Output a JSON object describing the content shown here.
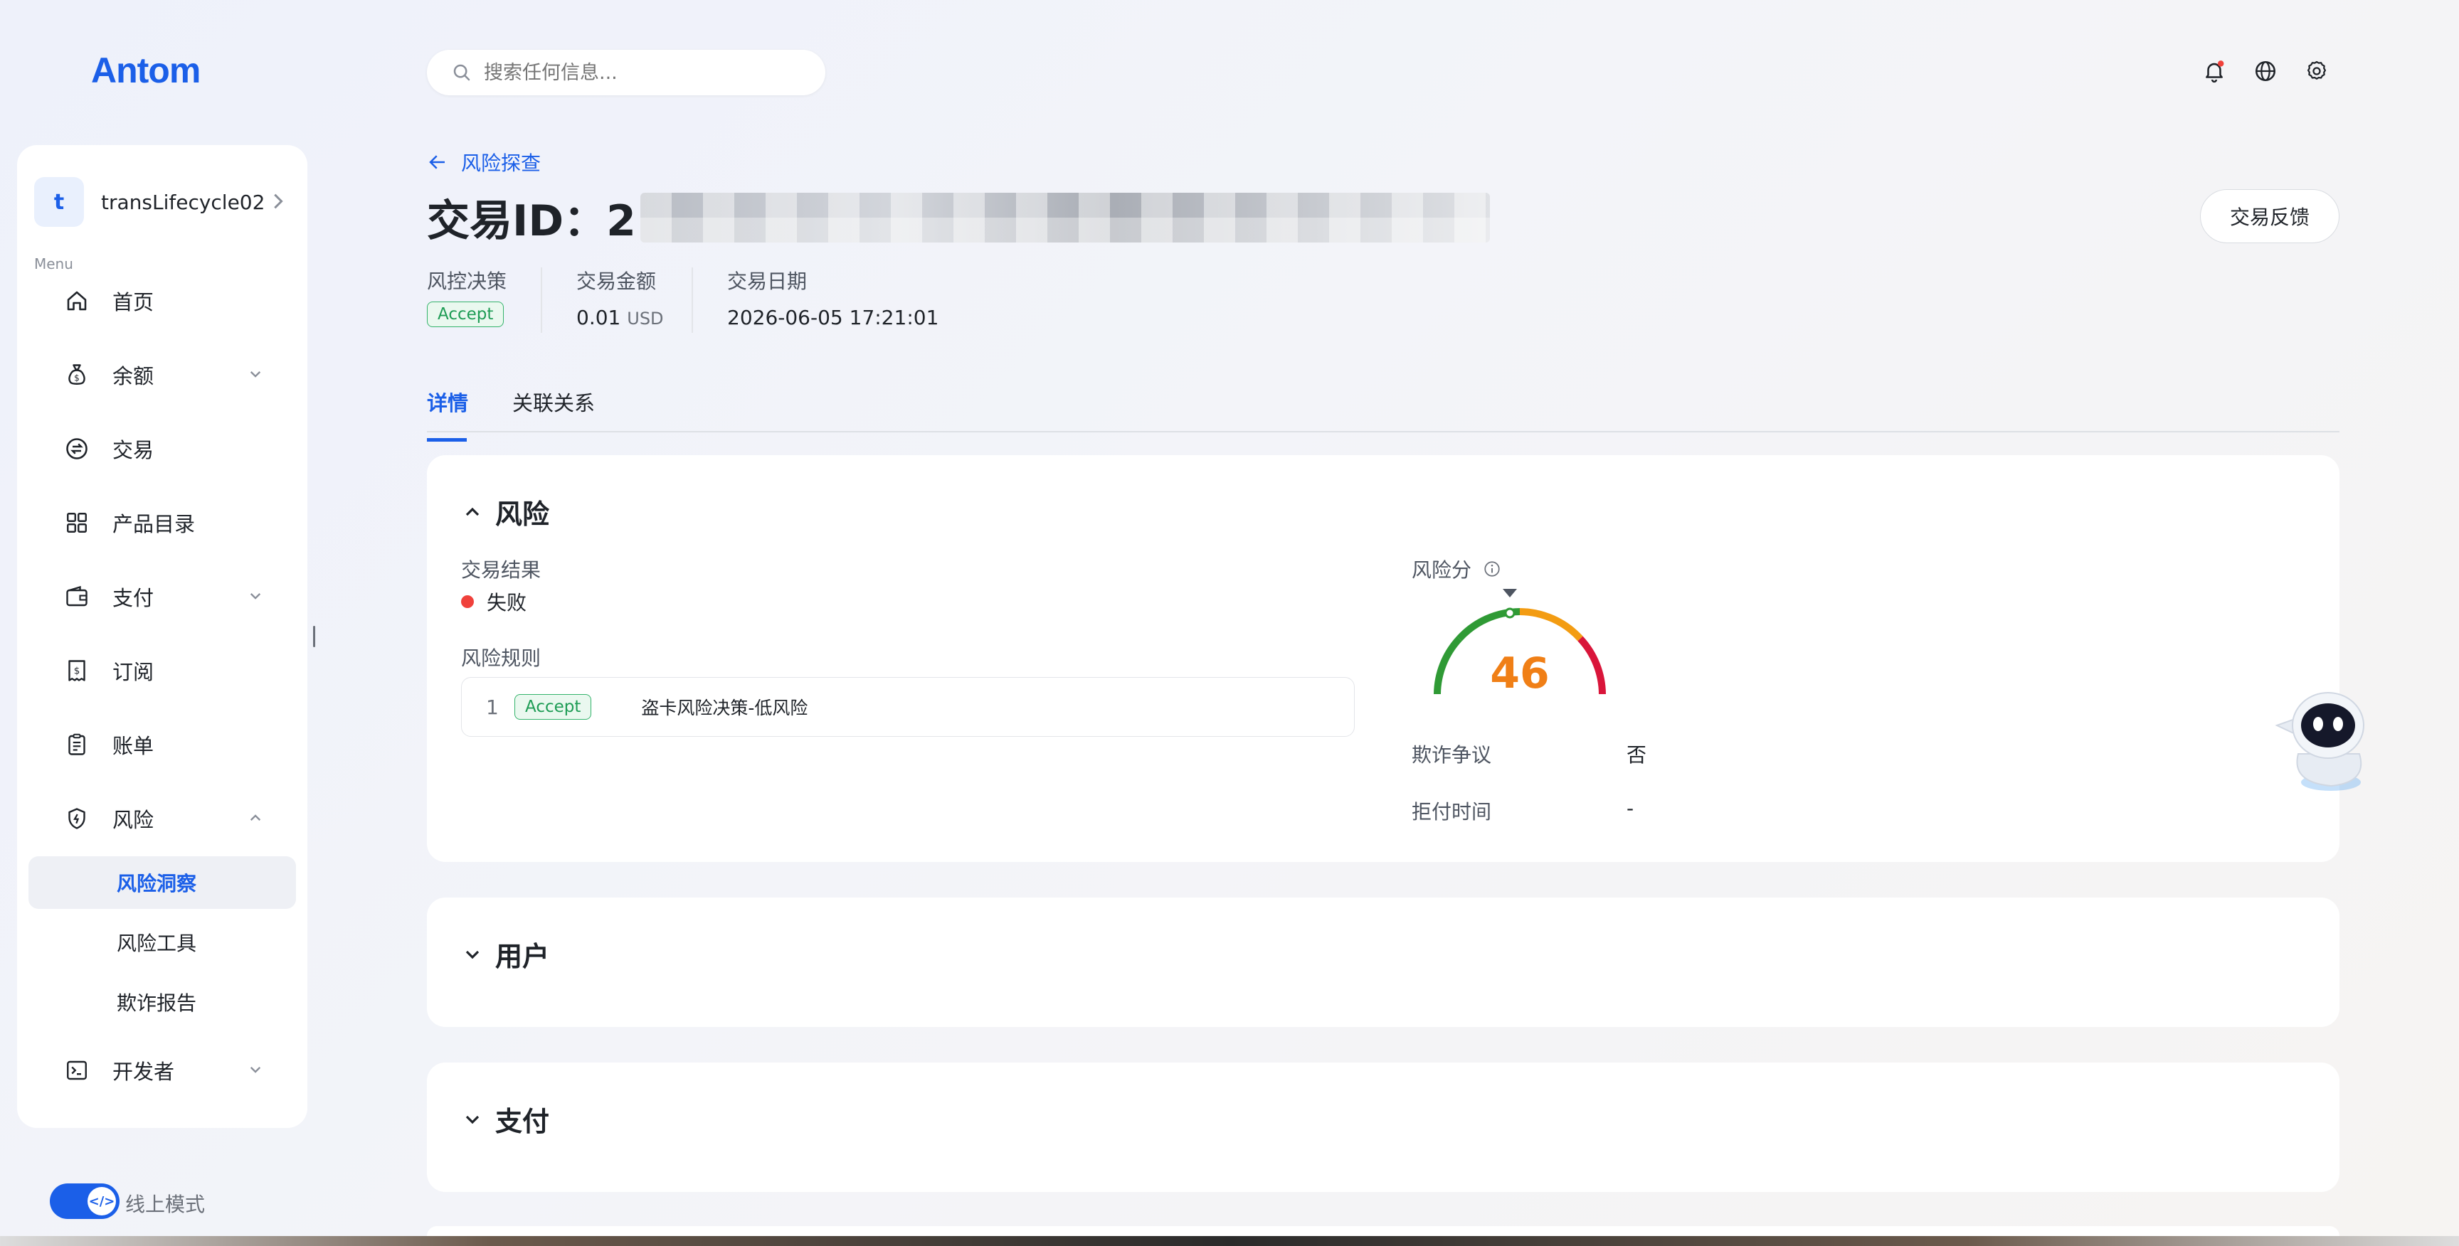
{
  "app": {
    "logo": "Antom"
  },
  "header": {
    "search_placeholder": "搜索任何信息..."
  },
  "sidebar": {
    "account": {
      "initial": "t",
      "name": "transLifecycle02"
    },
    "menu_label": "Menu",
    "items": [
      {
        "label": "首页",
        "icon": "home-icon"
      },
      {
        "label": "余额",
        "icon": "money-bag-icon"
      },
      {
        "label": "交易",
        "icon": "exchange-icon"
      },
      {
        "label": "产品目录",
        "icon": "grid-icon"
      },
      {
        "label": "支付",
        "icon": "wallet-icon"
      },
      {
        "label": "订阅",
        "icon": "receipt-icon"
      },
      {
        "label": "账单",
        "icon": "bill-icon"
      },
      {
        "label": "风险",
        "icon": "shield-icon"
      }
    ],
    "risk_sub": [
      "风险洞察",
      "风险工具",
      "欺诈报告"
    ],
    "developer": {
      "label": "开发者",
      "icon": "terminal-icon"
    },
    "mode_label": "线上模式"
  },
  "page": {
    "back_label": "风险探查",
    "title_prefix": "交易ID：2",
    "feedback_button": "交易反馈",
    "meta": {
      "decision_label": "风控决策",
      "decision_value": "Accept",
      "amount_label": "交易金额",
      "amount_value": "0.01",
      "amount_currency": "USD",
      "date_label": "交易日期",
      "date_value": "2026-06-05 17:21:01"
    },
    "tabs": [
      "详情",
      "关联关系"
    ]
  },
  "risk_card": {
    "title": "风险",
    "result_label": "交易结果",
    "result_value": "失败",
    "rules_label": "风险规则",
    "rule": {
      "index": "1",
      "badge": "Accept",
      "name": "盗卡风险决策-低风险"
    },
    "score_label": "风险分",
    "score": "46",
    "score_fraction": 0.46,
    "fraud_dispute_label": "欺诈争议",
    "fraud_dispute_value": "否",
    "chargeback_label": "拒付时间",
    "chargeback_value": "-"
  },
  "user_card": {
    "title": "用户"
  },
  "payment_card": {
    "title": "支付"
  },
  "colors": {
    "brand": "#1b5fe8",
    "success": "#34b36b",
    "danger": "#f0413b",
    "score": "#f07f16"
  }
}
